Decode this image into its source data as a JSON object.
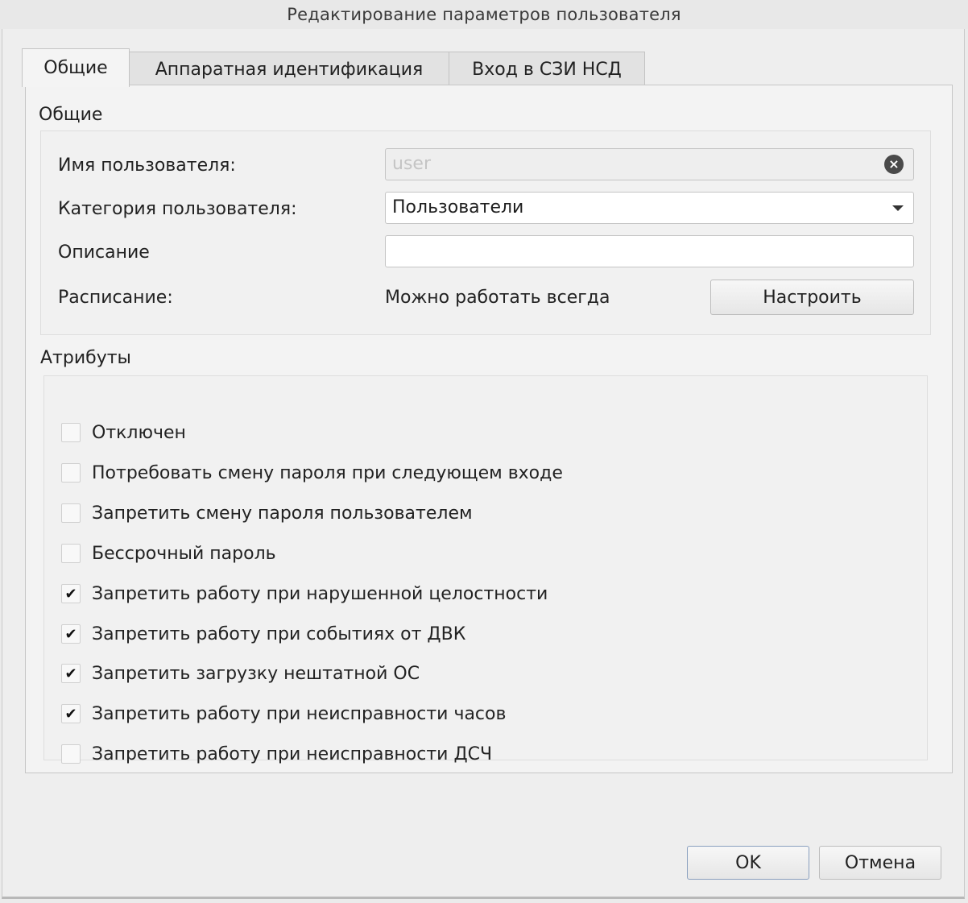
{
  "window": {
    "title": "Редактирование параметров пользователя"
  },
  "tabs": [
    {
      "label": "Общие",
      "active": true
    },
    {
      "label": "Аппаратная идентификация",
      "active": false
    },
    {
      "label": "Вход в СЗИ НСД",
      "active": false
    }
  ],
  "general": {
    "group_title": "Общие",
    "username": {
      "label": "Имя пользователя:",
      "value": "user",
      "disabled": true
    },
    "category": {
      "label": "Категория пользователя:",
      "value": "Пользователи"
    },
    "description": {
      "label": "Описание",
      "value": ""
    },
    "schedule": {
      "label": "Расписание:",
      "value": "Можно работать всегда",
      "button": "Настроить"
    }
  },
  "attributes": {
    "group_title": "Атрибуты",
    "items": [
      {
        "label": "Отключен",
        "checked": false
      },
      {
        "label": "Потребовать смену пароля при следующем входе",
        "checked": false
      },
      {
        "label": "Запретить смену пароля пользователем",
        "checked": false
      },
      {
        "label": "Бессрочный пароль",
        "checked": false
      },
      {
        "label": "Запретить работу при нарушенной целостности",
        "checked": true
      },
      {
        "label": "Запретить работу при событиях от ДВК",
        "checked": true
      },
      {
        "label": "Запретить загрузку нештатной ОС",
        "checked": true
      },
      {
        "label": "Запретить работу при неисправности часов",
        "checked": true
      },
      {
        "label": "Запретить работу при неисправности ДСЧ",
        "checked": false
      }
    ]
  },
  "buttons": {
    "ok": "OK",
    "cancel": "Отмена"
  }
}
